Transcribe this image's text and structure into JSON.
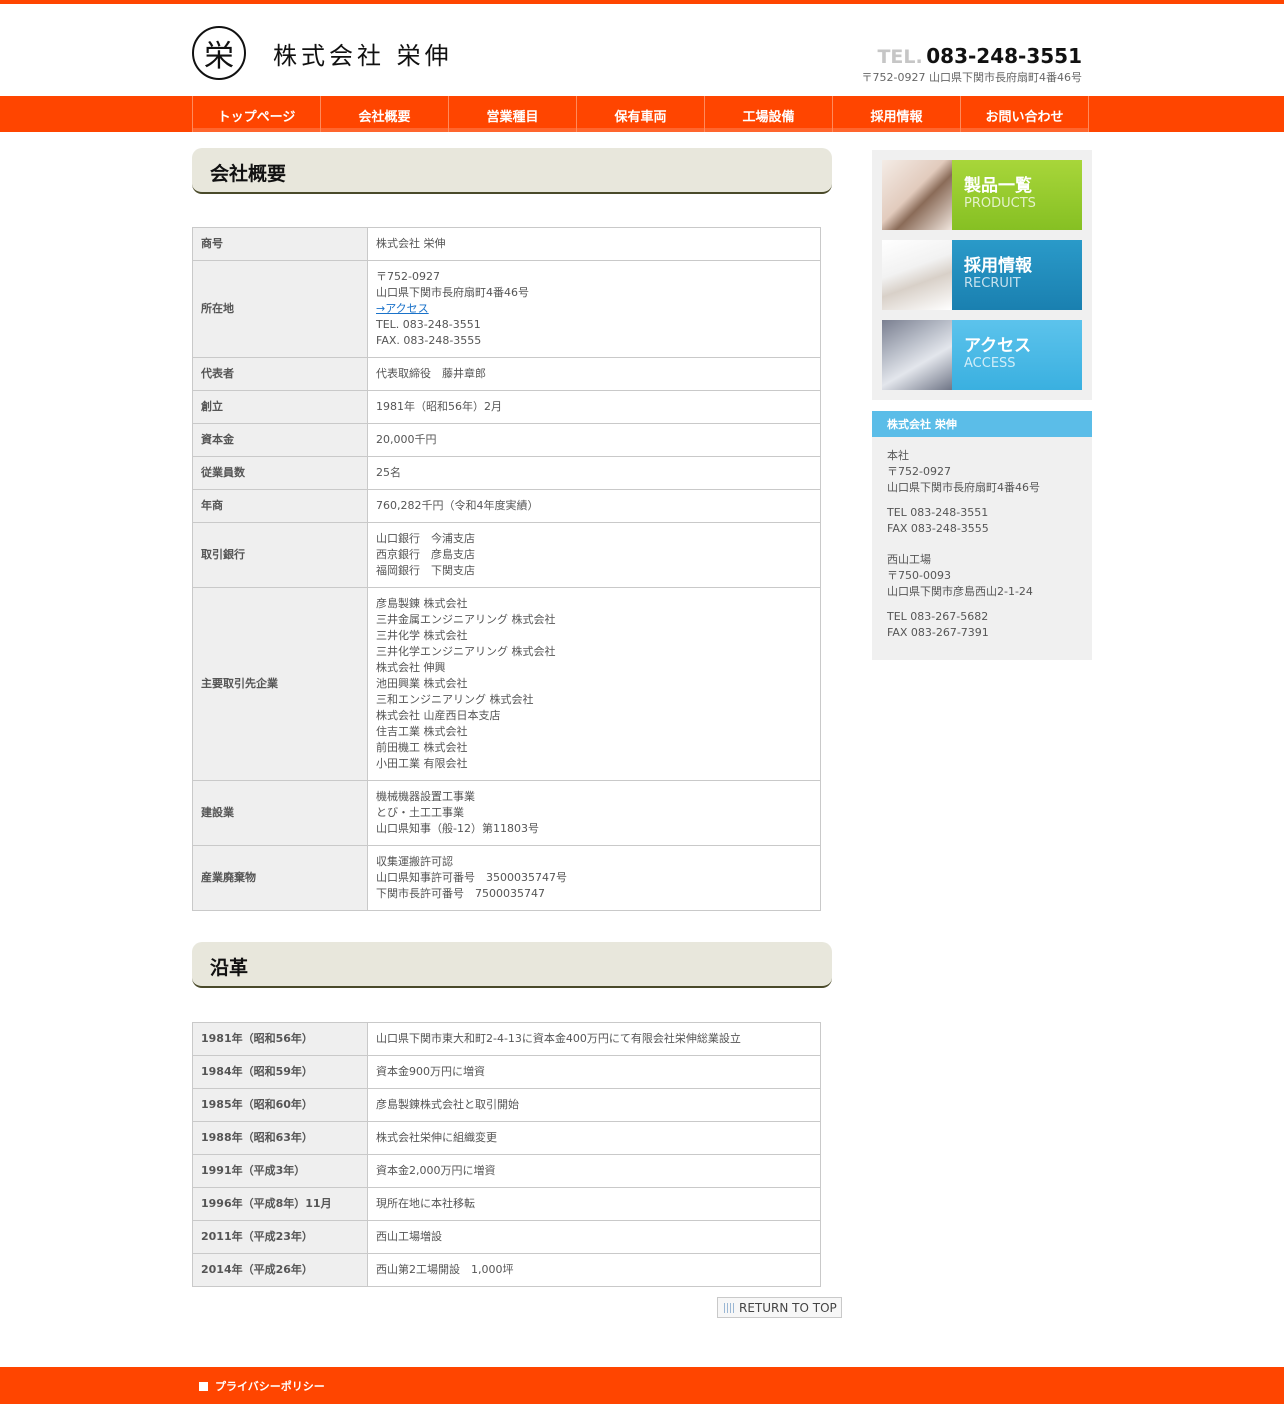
{
  "header": {
    "logo_char": "栄",
    "company_name": "株式会社 栄伸",
    "tel_label": "TEL.",
    "tel_number": "083-248-3551",
    "address": "〒752-0927 山口県下関市長府扇町4番46号"
  },
  "nav": [
    "トップページ",
    "会社概要",
    "営業種目",
    "保有車両",
    "工場設備",
    "採用情報",
    "お問い合わせ"
  ],
  "overview": {
    "title": "会社概要",
    "rows": [
      {
        "key": "商号",
        "lines": [
          "株式会社 栄伸"
        ]
      },
      {
        "key": "所在地",
        "lines": [
          "〒752-0927",
          "山口県下関市長府扇町4番46号"
        ],
        "link": "→アクセス",
        "lines2": [
          "TEL. 083-248-3551",
          "FAX. 083-248-3555"
        ]
      },
      {
        "key": "代表者",
        "lines": [
          "代表取締役　藤井章郎"
        ]
      },
      {
        "key": "創立",
        "lines": [
          "1981年（昭和56年）2月"
        ]
      },
      {
        "key": "資本金",
        "lines": [
          "20,000千円"
        ]
      },
      {
        "key": "従業員数",
        "lines": [
          "25名"
        ]
      },
      {
        "key": "年商",
        "lines": [
          "760,282千円（令和4年度実績）"
        ]
      },
      {
        "key": "取引銀行",
        "lines": [
          "山口銀行　今浦支店",
          "西京銀行　彦島支店",
          "福岡銀行　下関支店"
        ]
      },
      {
        "key": "主要取引先企業",
        "lines": [
          "彦島製錬 株式会社",
          "三井金属エンジニアリング 株式会社",
          "三井化学 株式会社",
          "三井化学エンジニアリング 株式会社",
          "株式会社 伸興",
          "池田興業 株式会社",
          "三和エンジニアリング 株式会社",
          "株式会社 山産西日本支店",
          "住吉工業 株式会社",
          "前田機工 株式会社",
          "小田工業 有限会社"
        ]
      },
      {
        "key": "建設業",
        "lines": [
          "機械機器設置工事業",
          "とび・土工工事業",
          "山口県知事（般-12）第11803号"
        ]
      },
      {
        "key": "産業廃棄物",
        "lines": [
          "収集運搬許可認",
          "山口県知事許可番号　3500035747号",
          "下関市長許可番号　7500035747"
        ]
      }
    ]
  },
  "history": {
    "title": "沿革",
    "rows": [
      {
        "key": "1981年（昭和56年）",
        "value": "山口県下関市東大和町2-4-13に資本金400万円にて有限会社栄伸総業設立"
      },
      {
        "key": "1984年（昭和59年）",
        "value": "資本金900万円に増資"
      },
      {
        "key": "1985年（昭和60年）",
        "value": "彦島製錬株式会社と取引開始"
      },
      {
        "key": "1988年（昭和63年）",
        "value": "株式会社栄伸に組織変更"
      },
      {
        "key": "1991年（平成3年）",
        "value": "資本金2,000万円に増資"
      },
      {
        "key": "1996年（平成8年）11月",
        "value": "現所在地に本社移転"
      },
      {
        "key": "2011年（平成23年）",
        "value": "西山工場増設"
      },
      {
        "key": "2014年（平成26年）",
        "value": "西山第2工場開設　1,000坪"
      }
    ]
  },
  "return_top": "RETURN TO TOP",
  "sidebar": {
    "banners": [
      {
        "jp": "製品一覧",
        "en": "PRODUCTS"
      },
      {
        "jp": "採用情報",
        "en": "RECRUIT"
      },
      {
        "jp": "アクセス",
        "en": "ACCESS"
      }
    ],
    "info_title": "株式会社 栄伸",
    "hq": [
      "本社",
      "〒752-0927",
      "山口県下関市長府扇町4番46号"
    ],
    "hq_contact": [
      "TEL 083-248-3551",
      "FAX 083-248-3555"
    ],
    "factory": [
      "西山工場",
      "〒750-0093",
      "山口県下関市彦島西山2-1-24"
    ],
    "factory_contact": [
      "TEL 083-267-5682",
      "FAX 083-267-7391"
    ]
  },
  "footer": {
    "privacy": "プライバシーポリシー"
  }
}
